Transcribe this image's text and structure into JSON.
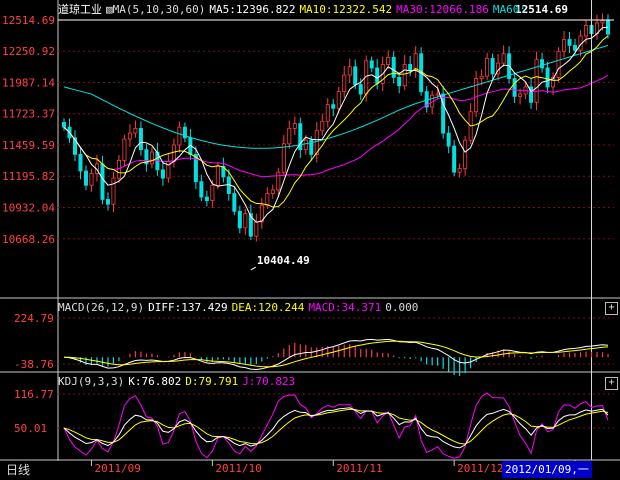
{
  "tab": {
    "label": "日线"
  },
  "cursor": {
    "date": "2012/01/09,一"
  },
  "price_panel": {
    "symbol": "道琼工业",
    "ma_label": "MA(5,10,30,60)",
    "ma5": "MA5:12396.822",
    "ma10": "MA10:12322.542",
    "ma30": "MA30:12066.186",
    "ma60": "MA60:",
    "high_label": "12514.69",
    "low_label": "10404.49",
    "y_ticks": [
      "12514.69",
      "12250.92",
      "11987.14",
      "11723.37",
      "11459.59",
      "11195.82",
      "10932.04",
      "10668.26"
    ],
    "colors": {
      "up": "#ff3c3c",
      "down": "#00e0e0",
      "ma5": "#ffffff",
      "ma10": "#ffff00",
      "ma30": "#ff00ff",
      "ma60": "#00e0e0"
    }
  },
  "macd_panel": {
    "label": "MACD(26,12,9)",
    "diff": "DIFF:137.429",
    "dea": "DEA:120.244",
    "macd": "MACD:34.371",
    "zero": "0.000",
    "y_ticks": [
      "224.79",
      "-38.76"
    ]
  },
  "kdj_panel": {
    "label": "KDJ(9,3,3)",
    "k": "K:76.802",
    "d": "D:79.791",
    "j": "J:70.823",
    "y_ticks": [
      "116.77",
      "50.01"
    ]
  },
  "x_ticks": [
    "2011/09",
    "2011/10",
    "2011/11",
    "2011/12",
    "2012/01"
  ],
  "chart_data": {
    "type": "candlestick",
    "title": "道琼工业",
    "y_range": [
      10404.49,
      12514.69
    ],
    "x_ticks": [
      "2011/09",
      "2011/10",
      "2011/11",
      "2011/12",
      "2012/01"
    ],
    "closes": [
      11610,
      11520,
      11380,
      11240,
      11120,
      11220,
      11300,
      11000,
      10960,
      11180,
      11330,
      11510,
      11560,
      11600,
      11420,
      11300,
      11400,
      11250,
      11180,
      11320,
      11460,
      11610,
      11520,
      11380,
      11150,
      11020,
      10990,
      11120,
      11280,
      11190,
      11050,
      10900,
      10760,
      10880,
      10690,
      10810,
      10950,
      11050,
      11080,
      11230,
      11470,
      11600,
      11640,
      11420,
      11500,
      11380,
      11580,
      11660,
      11800,
      11770,
      11910,
      12050,
      12120,
      11970,
      11890,
      12170,
      12110,
      11980,
      12140,
      12200,
      12030,
      11960,
      12140,
      12090,
      12230,
      11910,
      11780,
      11880,
      11890,
      11560,
      11450,
      11230,
      11260,
      11500,
      11740,
      12020,
      12040,
      12190,
      12060,
      12150,
      12230,
      12020,
      11870,
      11890,
      11950,
      11820,
      12180,
      12110,
      11950,
      12030,
      12250,
      12350,
      12300,
      12260,
      12380,
      12470,
      12400,
      12490,
      12510,
      12395
    ],
    "ma5_last": 12396.822,
    "ma10_last": 12322.542,
    "ma30_last": 12066.186,
    "macd": {
      "diff_last": 137.429,
      "dea_last": 120.244,
      "macd_last": 34.371,
      "y_ticks": [
        224.79,
        -38.76
      ]
    },
    "kdj": {
      "k_last": 76.802,
      "d_last": 79.791,
      "j_last": 70.823,
      "y_ticks": [
        116.77,
        50.01
      ]
    }
  }
}
